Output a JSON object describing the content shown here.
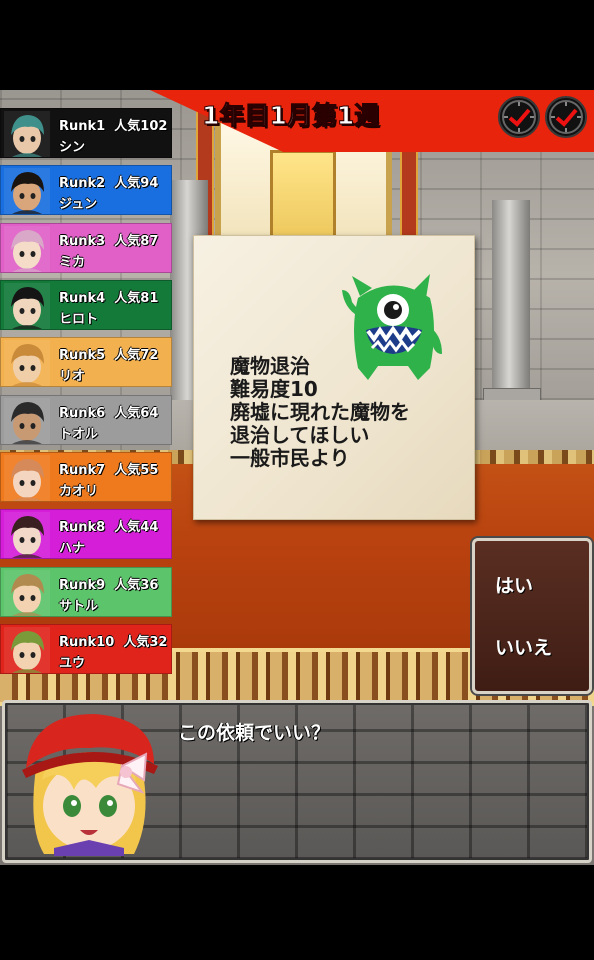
{
  "header": {
    "date": "1年目1月第1週",
    "clocks": [
      "clock-icon",
      "clock-icon"
    ]
  },
  "ranking": [
    {
      "rank": "Runk1",
      "popularity": "人気102",
      "name": "シン",
      "color": "#111111",
      "hair": "#3f8f8a",
      "skin": "#e8c8a8"
    },
    {
      "rank": "Runk2",
      "popularity": "人気94",
      "name": "ジュン",
      "color": "#1a6fe0",
      "hair": "#1a1410",
      "skin": "#d9a57a"
    },
    {
      "rank": "Runk3",
      "popularity": "人気87",
      "name": "ミカ",
      "color": "#e060c8",
      "hair": "#d9a8c8",
      "skin": "#f4dcc8"
    },
    {
      "rank": "Runk4",
      "popularity": "人気81",
      "name": "ヒロト",
      "color": "#137a3a",
      "hair": "#151515",
      "skin": "#f0d6bc"
    },
    {
      "rank": "Runk5",
      "popularity": "人気72",
      "name": "リオ",
      "color": "#f2b04e",
      "hair": "#c98a3a",
      "skin": "#f0cfa8"
    },
    {
      "rank": "Runk6",
      "popularity": "人気64",
      "name": "トオル",
      "color": "#9c9c9c",
      "hair": "#2a2a2a",
      "skin": "#c89a74"
    },
    {
      "rank": "Runk7",
      "popularity": "人気55",
      "name": "カオリ",
      "color": "#ef7a1e",
      "hair": "#d68a5a",
      "skin": "#f4d6c0"
    },
    {
      "rank": "Runk8",
      "popularity": "人気44",
      "name": "ハナ",
      "color": "#d41ed8",
      "hair": "#3a2020",
      "skin": "#f2d8c8"
    },
    {
      "rank": "Runk9",
      "popularity": "人気36",
      "name": "サトル",
      "color": "#5cc46a",
      "hair": "#b08a4e",
      "skin": "#f2d2b0"
    },
    {
      "rank": "Runk10",
      "popularity": "人気32",
      "name": "ユウ",
      "color": "#e0241c",
      "hair": "#7a9a3a",
      "skin": "#f2d2b0"
    }
  ],
  "quest": {
    "title": "魔物退治",
    "difficulty": "難易度10",
    "description_line1": "廃墟に現れた魔物を",
    "description_line2": "退治してほしい",
    "client": "一般市民より",
    "monster_color": "#2fb24a",
    "monster_icon": "green-one-eyed-monster"
  },
  "choices": {
    "yes": "はい",
    "no": "いいえ"
  },
  "dialog": {
    "text": "この依頼でいい？",
    "speaker_icon": "blonde-girl-red-hat-avatar"
  }
}
